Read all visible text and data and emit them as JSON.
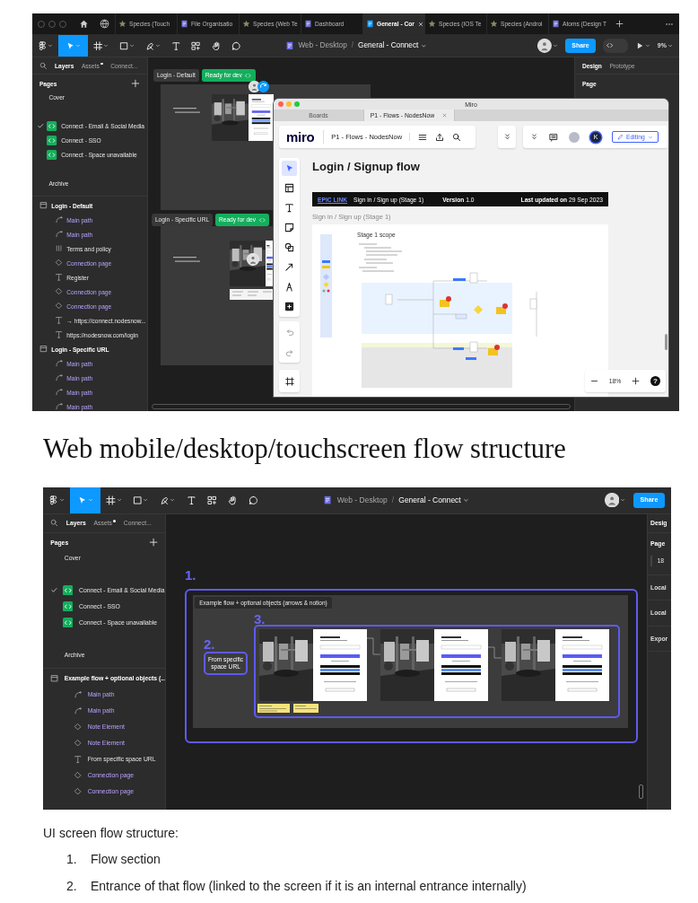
{
  "shots": [
    {
      "tabs": [
        {
          "label": "Species (Touch",
          "kind": "star",
          "selected": false
        },
        {
          "label": "File Organisatio",
          "kind": "file",
          "selected": false
        },
        {
          "label": "Species (Web Te",
          "kind": "star",
          "selected": false
        },
        {
          "label": "Dashboard",
          "kind": "file",
          "selected": false
        },
        {
          "label": "General - Cor",
          "kind": "file",
          "selected": true
        },
        {
          "label": "Species (IOS Te",
          "kind": "star",
          "selected": false
        },
        {
          "label": "Species (Androi",
          "kind": "star",
          "selected": false
        },
        {
          "label": "Atoms (Design T",
          "kind": "file",
          "selected": false
        }
      ],
      "tools": [
        {
          "kind": "menu",
          "selected": false
        },
        {
          "kind": "move",
          "selected": true
        },
        {
          "kind": "frame",
          "selected": false
        },
        {
          "kind": "rectangle",
          "selected": false
        },
        {
          "kind": "pen",
          "selected": false
        },
        {
          "kind": "text",
          "selected": false
        },
        {
          "kind": "resources",
          "selected": false
        },
        {
          "kind": "hand",
          "selected": false
        },
        {
          "kind": "comment",
          "selected": false
        }
      ],
      "breadcrumb": {
        "project": "Web - Desktop",
        "separator": "/",
        "file": "General - Connect"
      },
      "share": "Share",
      "zoom": "9%",
      "dev_mode": false,
      "panel_tabs": [
        {
          "label": "Layers",
          "selected": true,
          "dot": false
        },
        {
          "label": "Assets",
          "selected": false,
          "dot": true
        },
        {
          "label": "Connect...",
          "selected": false,
          "dot": false
        }
      ],
      "pages_title": "Pages",
      "pages": [
        {
          "label": "Cover",
          "kind": "plain",
          "selected": false
        },
        {
          "label": "Connect - Email & Social Media",
          "kind": "dev",
          "selected": true
        },
        {
          "label": "Connect - SSO",
          "kind": "dev",
          "selected": false
        },
        {
          "label": "Connect - Space unavailable",
          "kind": "dev",
          "selected": false
        },
        {
          "label": "Archive",
          "kind": "plain",
          "selected": false
        }
      ],
      "layers": [
        {
          "label": "Login - Default",
          "kind": "frame",
          "children": [
            {
              "label": "Main path",
              "kind": "path"
            },
            {
              "label": "Main path",
              "kind": "path"
            },
            {
              "label": "Terms and policy",
              "kind": "group"
            },
            {
              "label": "Connection page",
              "kind": "component"
            },
            {
              "label": "Register",
              "kind": "text"
            },
            {
              "label": "Connection page",
              "kind": "component"
            },
            {
              "label": "Connection page",
              "kind": "component"
            },
            {
              "label": "→ https://connect.nodesnow...",
              "kind": "text"
            },
            {
              "label": "https://nodesnow.com/login",
              "kind": "text"
            }
          ]
        },
        {
          "label": "Login - Specific URL",
          "kind": "frame",
          "children": [
            {
              "label": "Main path",
              "kind": "path"
            },
            {
              "label": "Main path",
              "kind": "path"
            },
            {
              "label": "Main path",
              "kind": "path"
            },
            {
              "label": "Main path",
              "kind": "path"
            }
          ]
        }
      ],
      "right_panel": {
        "tabs": [
          {
            "label": "Design",
            "selected": true
          },
          {
            "label": "Prototype",
            "selected": false
          }
        ],
        "rows": [
          {
            "kind": "title",
            "label": "Page"
          }
        ]
      },
      "canvas": {
        "kind": "frames",
        "frames": [
          {
            "label": "Login - Default",
            "status": "Ready for dev"
          },
          {
            "label": "Login - Specific URL",
            "status": "Ready for dev"
          }
        ]
      },
      "miro": {
        "title": "Miro",
        "tabs": [
          {
            "label": "Boards",
            "selected": false
          },
          {
            "label": "P1 - Flows - NodesNow",
            "selected": true
          }
        ],
        "logo": "miro",
        "board_name": "P1 - Flows - NodesNow",
        "avatar_initial": "K",
        "mode": "Editing",
        "tools": [
          {
            "kind": "select",
            "selected": true
          },
          {
            "kind": "templates",
            "selected": false
          },
          {
            "kind": "text",
            "selected": false
          },
          {
            "kind": "sticky",
            "selected": false
          },
          {
            "kind": "shapes",
            "selected": false
          },
          {
            "kind": "arrow",
            "selected": false
          },
          {
            "kind": "pen",
            "selected": false
          },
          {
            "kind": "add",
            "selected": false
          }
        ],
        "heading": "Login / Signup flow",
        "info": {
          "link": "EPIC LINK",
          "stage": "Sign in / Sign up (Stage 1)",
          "version": "**Version** 1.0",
          "updated": "**Last updated on** 29 Sep 2023"
        },
        "subtitle": "Sign in / Sign up (Stage 1)",
        "board_title": "Stage 1 scope",
        "zoom": "18%",
        "help": "?"
      }
    },
    {
      "tools": [
        {
          "kind": "menu",
          "selected": false
        },
        {
          "kind": "move",
          "selected": true
        },
        {
          "kind": "frame",
          "selected": false
        },
        {
          "kind": "rectangle",
          "selected": false
        },
        {
          "kind": "pen",
          "selected": false
        },
        {
          "kind": "text",
          "selected": false
        },
        {
          "kind": "resources",
          "selected": false
        },
        {
          "kind": "hand",
          "selected": false
        },
        {
          "kind": "comment",
          "selected": false
        }
      ],
      "breadcrumb": {
        "project": "Web - Desktop",
        "separator": "/",
        "file": "General - Connect"
      },
      "share": "Share",
      "panel_tabs": [
        {
          "label": "Layers",
          "selected": true,
          "dot": false
        },
        {
          "label": "Assets",
          "selected": false,
          "dot": true
        },
        {
          "label": "Connect...",
          "selected": false,
          "dot": false
        }
      ],
      "pages_title": "Pages",
      "pages": [
        {
          "label": "Cover",
          "kind": "plain",
          "selected": false
        },
        {
          "label": "Connect - Email & Social Media",
          "kind": "dev",
          "selected": true
        },
        {
          "label": "Connect - SSO",
          "kind": "dev",
          "selected": false
        },
        {
          "label": "Connect - Space unavailable",
          "kind": "dev",
          "selected": false
        },
        {
          "label": "Archive",
          "kind": "plain",
          "selected": false
        }
      ],
      "layers": [
        {
          "label": "Example flow + optional objects (...",
          "kind": "frame",
          "children": [
            {
              "label": "Main path",
              "kind": "path"
            },
            {
              "label": "Main path",
              "kind": "path"
            },
            {
              "label": "Note Element",
              "kind": "component"
            },
            {
              "label": "Note Element",
              "kind": "component"
            },
            {
              "label": "From specific space URL",
              "kind": "text"
            },
            {
              "label": "Connection page",
              "kind": "component"
            },
            {
              "label": "Connection page",
              "kind": "component"
            }
          ]
        }
      ],
      "right_panel": {
        "tabs": [
          {
            "label": "Desig",
            "selected": true
          }
        ],
        "rows": [
          {
            "kind": "title",
            "label": "Page"
          },
          {
            "kind": "swatch",
            "label": "18"
          },
          {
            "kind": "section",
            "label": "Local"
          },
          {
            "kind": "section",
            "label": "Local"
          },
          {
            "kind": "section",
            "label": "Expor"
          }
        ]
      },
      "canvas": {
        "kind": "flow",
        "section_number": "1.",
        "section_title": "Example flow + optional objects (arrows & notion)",
        "entrance_number": "2.",
        "entrance_label": "From specific space URL",
        "screens_number": "3."
      }
    }
  ],
  "heading": "Web mobile/desktop/touchscreen flow structure",
  "notes": {
    "intro": "UI screen flow structure:",
    "items": [
      {
        "number": "1.",
        "text": "Flow section"
      },
      {
        "number": "2.",
        "text": "Entrance of that flow (linked to the screen if it is an internal entrance internally)"
      }
    ]
  }
}
